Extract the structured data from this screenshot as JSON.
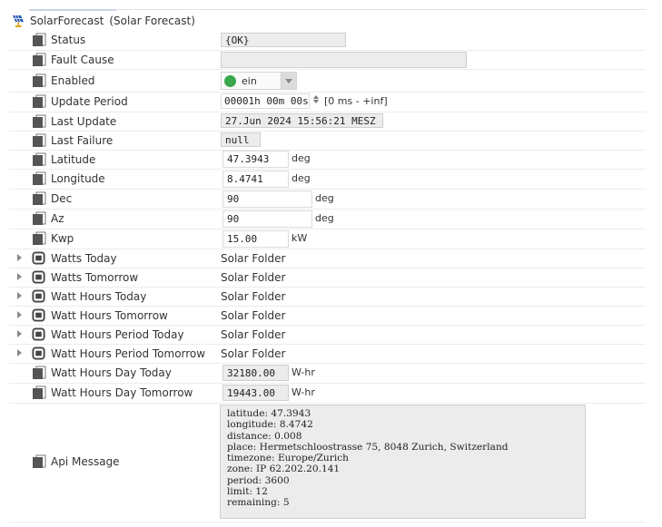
{
  "root": {
    "name": "SolarForecast",
    "type": "(Solar Forecast)"
  },
  "properties": {
    "status": {
      "label": "Status",
      "value": "{OK}"
    },
    "fault_cause": {
      "label": "Fault Cause",
      "value": ""
    },
    "enabled": {
      "label": "Enabled",
      "value": "ein",
      "state_color": "#3aa84a"
    },
    "update_period": {
      "label": "Update Period",
      "value": "00001h 00m 00s",
      "range": "[0 ms - +inf]"
    },
    "last_update": {
      "label": "Last Update",
      "value": "27.Jun 2024 15:56:21 MESZ"
    },
    "last_failure": {
      "label": "Last Failure",
      "value": "null"
    },
    "latitude": {
      "label": "Latitude",
      "value": "47.3943",
      "unit": "deg"
    },
    "longitude": {
      "label": "Longitude",
      "value": "8.4741",
      "unit": "deg"
    },
    "dec": {
      "label": "Dec",
      "value": "90",
      "unit": "deg"
    },
    "az": {
      "label": "Az",
      "value": "90",
      "unit": "deg"
    },
    "kwp": {
      "label": "Kwp",
      "value": "15.00",
      "unit": "kW"
    }
  },
  "folders": [
    {
      "label": "Watts Today",
      "value": "Solar Folder"
    },
    {
      "label": "Watts Tomorrow",
      "value": "Solar Folder"
    },
    {
      "label": "Watt Hours Today",
      "value": "Solar Folder"
    },
    {
      "label": "Watt Hours Tomorrow",
      "value": "Solar Folder"
    },
    {
      "label": "Watt Hours Period Today",
      "value": "Solar Folder"
    },
    {
      "label": "Watt Hours Period Tomorrow",
      "value": "Solar Folder"
    }
  ],
  "energy": {
    "day_today": {
      "label": "Watt Hours Day Today",
      "value": "32180.00",
      "unit": "W-hr"
    },
    "day_tomorrow": {
      "label": "Watt Hours Day Tomorrow",
      "value": "19443.00",
      "unit": "W-hr"
    }
  },
  "api_message": {
    "label": "Api Message",
    "text": "latitude: 47.3943\nlongitude: 8.4742\ndistance: 0.008\nplace: Hermetschloostrasse 75, 8048 Zurich, Switzerland\ntimezone: Europe/Zurich\nzone: IP 62.202.20.141\nperiod: 3600\nlimit: 12\nremaining: 5"
  }
}
